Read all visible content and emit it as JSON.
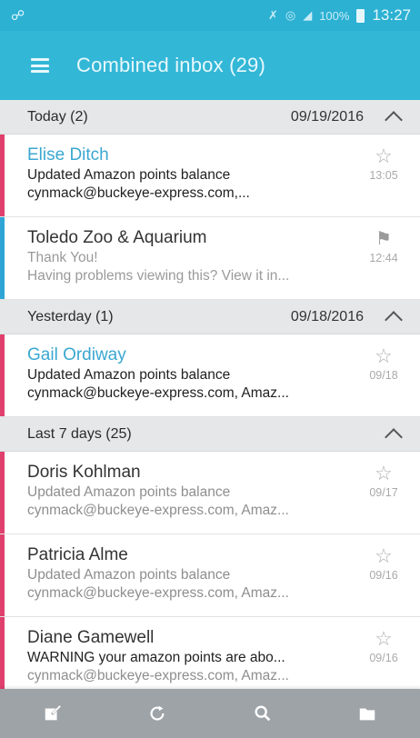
{
  "status_bar": {
    "time": "13:27",
    "battery": "100%"
  },
  "app_bar": {
    "menu_icon": "hamburger-menu-icon",
    "title": "Combined inbox (29)"
  },
  "sections": [
    {
      "title": "Today (2)",
      "date": "09/19/2016",
      "emails": [
        {
          "sender": "Elise Ditch",
          "subject": "Updated Amazon points balance",
          "preview": "cynmack@buckeye-express.com,...",
          "time": "13:05",
          "icon": "star-outline-icon",
          "state": "unread",
          "bar_color": "#e0406c"
        },
        {
          "sender": "Toledo Zoo & Aquarium",
          "subject": "Thank You!",
          "preview": "Having problems viewing this? View it in...",
          "time": "12:44",
          "icon": "flag-icon",
          "state": "toledo",
          "bar_color": "#2fa5d6"
        }
      ]
    },
    {
      "title": "Yesterday (1)",
      "date": "09/18/2016",
      "emails": [
        {
          "sender": "Gail Ordiway",
          "subject": "Updated Amazon points balance",
          "preview": "cynmack@buckeye-express.com, Amaz...",
          "time": "09/18",
          "icon": "star-outline-icon",
          "state": "unread",
          "bar_color": "#e0406c"
        }
      ]
    },
    {
      "title": "Last 7 days (25)",
      "date": "",
      "emails": [
        {
          "sender": "Doris Kohlman",
          "subject": "Updated Amazon points balance",
          "preview": "cynmack@buckeye-express.com, Amaz...",
          "time": "09/17",
          "icon": "star-outline-icon",
          "state": "read",
          "bar_color": "#e0406c"
        },
        {
          "sender": "Patricia Alme",
          "subject": "Updated Amazon points balance",
          "preview": "cynmack@buckeye-express.com, Amaz...",
          "time": "09/16",
          "icon": "star-outline-icon",
          "state": "read",
          "bar_color": "#e0406c"
        },
        {
          "sender": "Diane Gamewell",
          "subject": "WARNING your amazon points are abo...",
          "preview": "cynmack@buckeye-express.com, Amaz...",
          "time": "09/16",
          "icon": "star-outline-icon",
          "state": "warn",
          "bar_color": "#e0406c"
        }
      ]
    }
  ],
  "bottom_bar": {
    "items": [
      "compose-icon",
      "refresh-icon",
      "search-icon",
      "folder-icon"
    ]
  }
}
